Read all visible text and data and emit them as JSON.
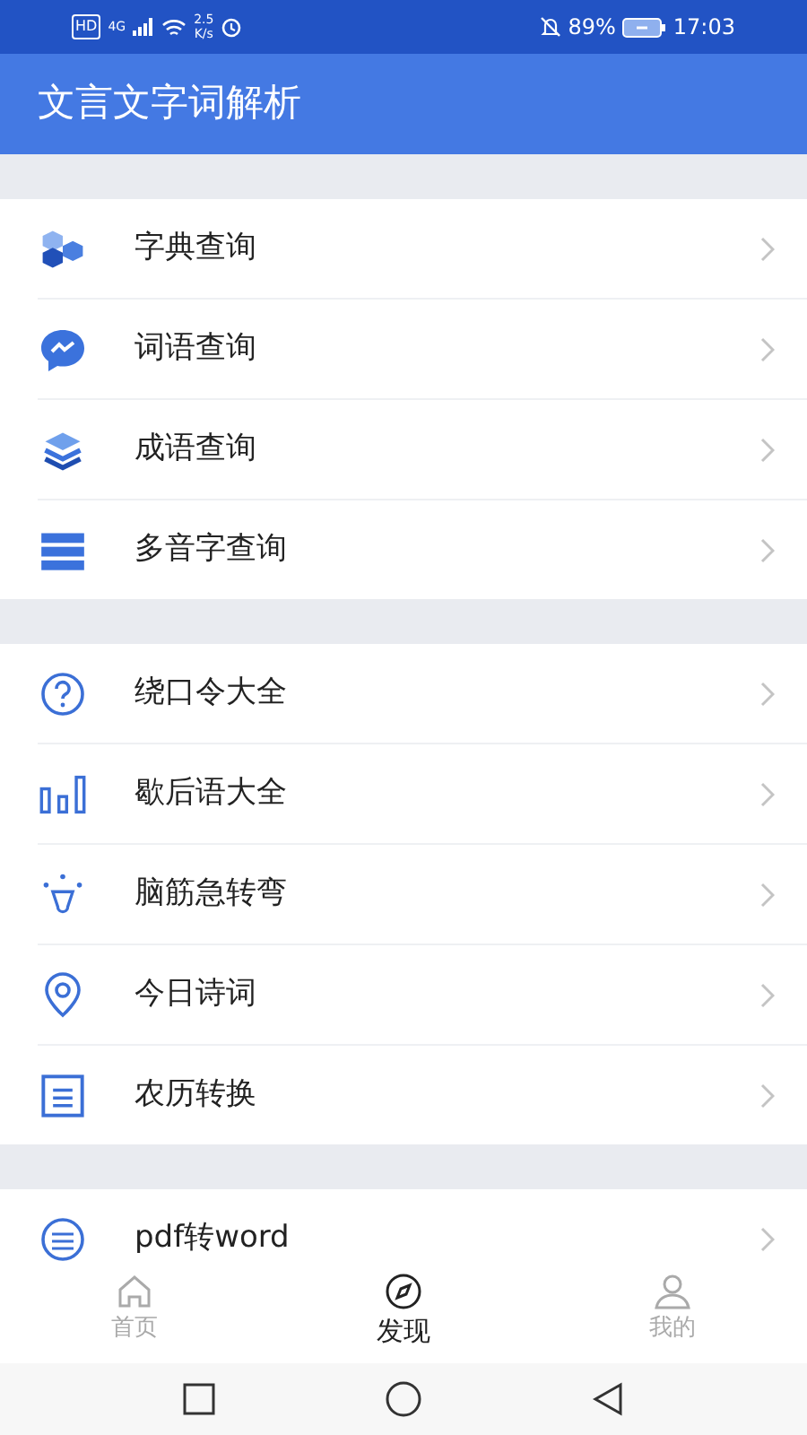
{
  "status_bar": {
    "hd": "HD",
    "network": "4G",
    "speed": "2.5",
    "speed_unit": "K/s",
    "battery": "89%",
    "time": "17:03"
  },
  "header": {
    "title": "文言文字词解析"
  },
  "sections": [
    {
      "items": [
        {
          "label": "字典查询"
        },
        {
          "label": "词语查询"
        },
        {
          "label": "成语查询"
        },
        {
          "label": "多音字查询"
        }
      ]
    },
    {
      "items": [
        {
          "label": "绕口令大全"
        },
        {
          "label": "歇后语大全"
        },
        {
          "label": "脑筋急转弯"
        },
        {
          "label": "今日诗词"
        },
        {
          "label": "农历转换"
        }
      ]
    },
    {
      "items": [
        {
          "label": "pdf转word"
        }
      ]
    }
  ],
  "tabs": [
    {
      "label": "首页",
      "selected": false
    },
    {
      "label": "发现",
      "selected": true
    },
    {
      "label": "我的",
      "selected": false
    }
  ]
}
